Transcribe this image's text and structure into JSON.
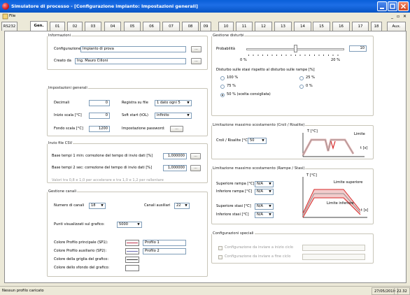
{
  "window": {
    "title": "Simulatore di processo - [Configurazione impianto: Impostazioni generali]"
  },
  "menu": {
    "file": "File"
  },
  "tabs": [
    "RS232",
    "Gen.",
    "01",
    "02",
    "03",
    "04",
    "05",
    "06",
    "07",
    "08",
    "09",
    "10",
    "11",
    "12",
    "13",
    "14",
    "15",
    "16",
    "17",
    "18",
    "Aux."
  ],
  "active_tab": "Gen.",
  "informazioni": {
    "legend": "Informazioni",
    "configurazione_label": "Configurazione",
    "configurazione_value": "Impianto di prova",
    "creato_label": "Creato da",
    "creato_value": "Ing. Mauro Cilloni",
    "browse": "..."
  },
  "impostazioni": {
    "legend": "Impostazioni generali",
    "decimali_label": "Decimali",
    "decimali_value": "0",
    "inizio_label": "Inizio scala [°C]",
    "inizio_value": "0",
    "fondo_label": "Fondo scala [°C]",
    "fondo_value": "1200",
    "registra_label": "Registra su file",
    "registra_value": "1 dato ogni 5",
    "soft_label": "Soft start (tOL)",
    "soft_value": "infinito",
    "password_label": "Impostazione password:",
    "password_btn": "..."
  },
  "csv": {
    "legend": "Invio file CSV",
    "base1_label": "Base tempi 1 min: correzione del tempo di invio dati [%]",
    "base1_value": "1,000000",
    "base2_label": "Base tempi 2 sec: correzione del tempo di invio dati [%]",
    "base2_value": "1,000000",
    "note": "Valori tra 0,8 e 1,0 per accelerare e tra 1,0 e 1,2 per rallentare",
    "btn": "..."
  },
  "canali": {
    "legend": "Gestione canali",
    "numero_label": "Numero di canali",
    "numero_value": "18",
    "ausiliari_label": "Canali ausiliari",
    "ausiliari_value": "22",
    "punti_label": "Punti visualizzati sul grafico:",
    "punti_value": "5000",
    "colore_sp1_label": "Colore Profilo principale (SP1):",
    "colore_sp1_name": "Profilo 1",
    "colore_sp1": "#c0304a",
    "colore_sp2_label": "Colore Profilo ausiliario (SP2):",
    "colore_sp2_name": "Profilo 2",
    "colore_sp2": "#6a6ab0",
    "griglia_label": "Colore della griglia del grafico:",
    "sfondo_label": "Colore dello sfondo del grafico:"
  },
  "disturbi": {
    "legend": "Gestione disturbi",
    "probabilita_label": "Probabilità",
    "probabilita_value": "10",
    "probabilita_level": 0.5,
    "scale_min": "0 %",
    "scale_max": "20 %",
    "rampe_label": "Disturbo sulle stasi rispetto al disturbo sulle rampe [%]",
    "options": [
      "100 %",
      "25 %",
      "75 %",
      "0 %",
      "50 % (scelta consigliata)"
    ],
    "selected": "50 % (scelta consigliata)"
  },
  "croli": {
    "legend": "Limitazione massimo scostamento (Croli / Risalite)",
    "label": "Croli / Risalite [°C]",
    "value": "50",
    "chart_t": "T [°C]",
    "chart_limite": "Limite",
    "chart_time": "t [s]"
  },
  "rampe": {
    "legend": "Limitazione massimo scostamento (Rampe / Stasi)",
    "sup_rampa_label": "Superiore rampa [°C]",
    "sup_rampa_value": "N/A",
    "inf_rampa_label": "Inferiore rampa [°C]",
    "inf_rampa_value": "N/A",
    "sup_stasi_label": "Superiore stasi [°C]",
    "sup_stasi_value": "N/A",
    "inf_stasi_label": "Inferiore stasi [°C]",
    "inf_stasi_value": "N/A",
    "chart_t": "T [°C]",
    "limite_sup": "Limite superiore",
    "limite_inf": "Limite inferiore",
    "chart_time": "t [s]"
  },
  "speciali": {
    "legend": "Configurazioni speciali",
    "inizio_label": "Configurazione da inviare a inizio ciclo",
    "fine_label": "Configurazione da inviare a fine ciclo"
  },
  "statusbar": {
    "left": "Nessun profilo caricato",
    "date": "27/05/2010",
    "time": "22.32"
  },
  "colors": {
    "title_blue": "#0a5fd8",
    "chart_red": "#d82a2a",
    "envelope": "#e8a5a5"
  }
}
